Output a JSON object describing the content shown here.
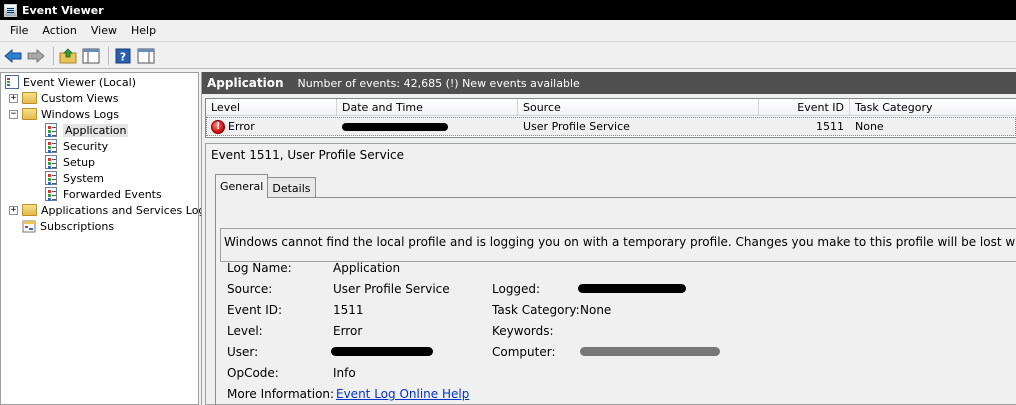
{
  "window": {
    "title": "Event Viewer"
  },
  "menu": {
    "items": [
      "File",
      "Action",
      "View",
      "Help"
    ]
  },
  "toolbar": {
    "buttons": [
      "back-arrow-icon",
      "forward-arrow-icon",
      "up-folder-icon",
      "show-hide-tree-icon",
      "help-icon",
      "action-pane-icon"
    ]
  },
  "tree": {
    "root": "Event Viewer (Local)",
    "custom_views": "Custom Views",
    "windows_logs": "Windows Logs",
    "logs": [
      "Application",
      "Security",
      "Setup",
      "System",
      "Forwarded Events"
    ],
    "apps_services": "Applications and Services Logs",
    "subscriptions": "Subscriptions"
  },
  "header": {
    "title": "Application",
    "info": "Number of events: 42,685 (!) New events available"
  },
  "grid": {
    "columns": [
      "Level",
      "Date and Time",
      "Source",
      "Event ID",
      "Task Category"
    ],
    "row": {
      "level": "Error",
      "date_time": "",
      "source": "User Profile Service",
      "event_id": "1511",
      "task_category": "None"
    }
  },
  "detail": {
    "title": "Event 1511, User Profile Service",
    "tabs": [
      "General",
      "Details"
    ],
    "description": "Windows cannot find the local profile and is logging you on with a temporary profile. Changes you make to this profile will be lost when you log off.",
    "labels": {
      "log_name": "Log Name:",
      "source": "Source:",
      "event_id": "Event ID:",
      "level": "Level:",
      "user": "User:",
      "opcode": "OpCode:",
      "more_info": "More Information:",
      "logged": "Logged:",
      "task_category": "Task Category:",
      "keywords": "Keywords:",
      "computer": "Computer:"
    },
    "values": {
      "log_name": "Application",
      "source": "User Profile Service",
      "event_id": "1511",
      "level": "Error",
      "user": "",
      "opcode": "Info",
      "more_info_link": "Event Log Online Help",
      "logged": "",
      "task_category": "None",
      "keywords": "",
      "computer": ""
    }
  },
  "colors": {
    "header_bg": "#505050",
    "link": "#0033cc",
    "error_red": "#cc0000"
  }
}
